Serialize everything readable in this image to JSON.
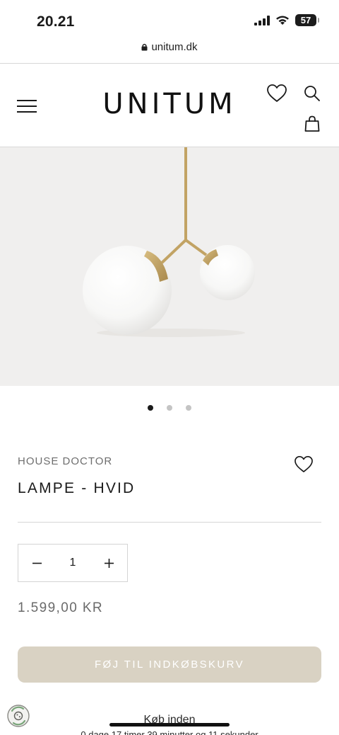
{
  "status_bar": {
    "time": "20.21",
    "battery": "57"
  },
  "browser": {
    "url": "unitum.dk"
  },
  "header": {
    "logo": "UNITUM"
  },
  "gallery": {
    "active_index": 0
  },
  "product": {
    "brand": "HOUSE DOCTOR",
    "title": "LAMPE - HVID",
    "quantity": "1",
    "price": "1.599,00 KR"
  },
  "cart": {
    "add_label": "FØJ TIL INDKØBSKURV"
  },
  "delivery": {
    "headline": "Køb inden",
    "detail": "0 dage 17 timer 39 minutter og 11 sekunder"
  },
  "colors": {
    "button_bg": "#d9d2c3",
    "image_bg": "#f0efee",
    "brass": "#c2a364"
  }
}
